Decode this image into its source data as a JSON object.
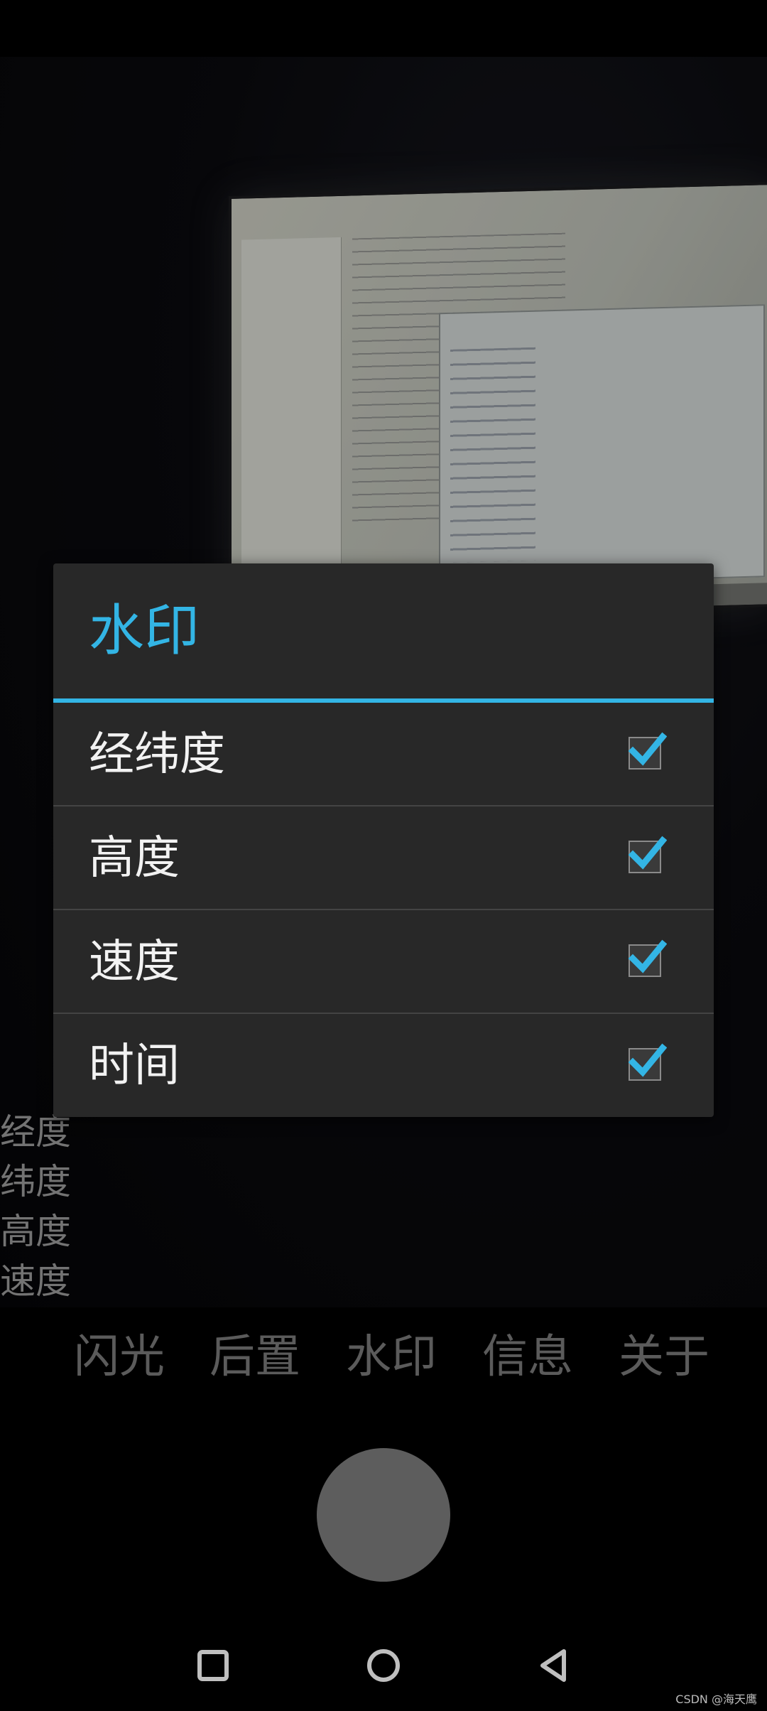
{
  "dialog": {
    "title": "水印",
    "options": [
      {
        "label": "经纬度",
        "checked": true
      },
      {
        "label": "高度",
        "checked": true
      },
      {
        "label": "速度",
        "checked": true
      },
      {
        "label": "时间",
        "checked": true
      }
    ]
  },
  "watermark_overlay": [
    "经度",
    "纬度",
    "高度",
    "速度"
  ],
  "bottom_menu": [
    "闪光",
    "后置",
    "水印",
    "信息",
    "关于"
  ],
  "nav": {
    "recents": "square-icon",
    "home": "circle-icon",
    "back": "triangle-back-icon"
  },
  "colors": {
    "accent": "#33b5e5",
    "dialog_bg": "#282828",
    "menu_text": "#7a7a7a"
  },
  "credit": "CSDN @海天鹰"
}
